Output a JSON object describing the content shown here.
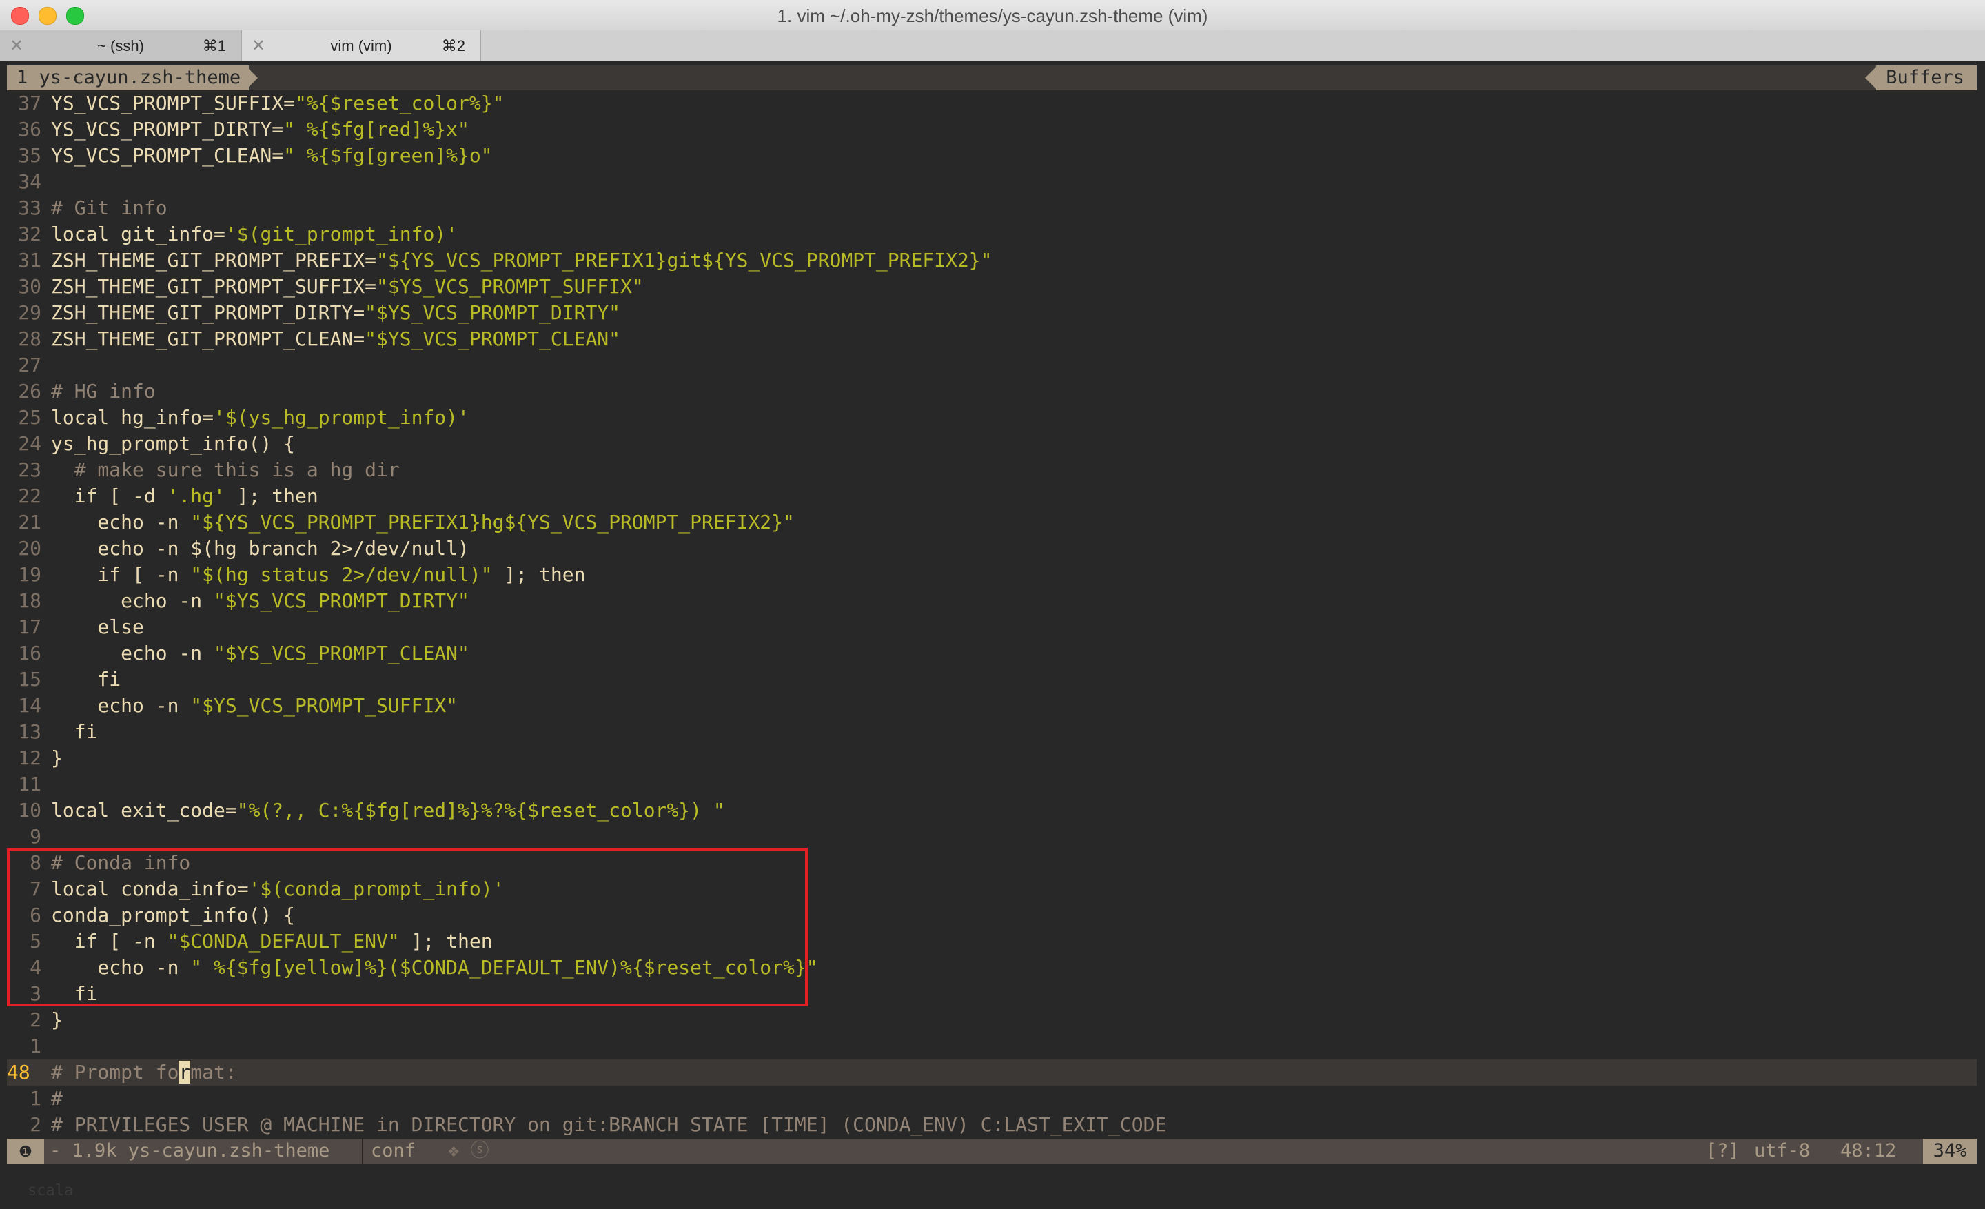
{
  "window": {
    "title": "1. vim ~/.oh-my-zsh/themes/ys-cayun.zsh-theme (vim)"
  },
  "tabs": [
    {
      "label": "~ (ssh)",
      "shortcut": "⌘1",
      "close": "✕"
    },
    {
      "label": "vim (vim)",
      "shortcut": "⌘2",
      "close": "✕"
    }
  ],
  "vim": {
    "buffer_tab": "1  ys-cayun.zsh-theme",
    "buffers_label": "Buffers",
    "lines": [
      {
        "n": "37",
        "segs": [
          [
            "v",
            "YS_VCS_PROMPT_SUFFIX="
          ],
          [
            "s",
            "\"%{$reset_color%}\""
          ]
        ]
      },
      {
        "n": "36",
        "segs": [
          [
            "v",
            "YS_VCS_PROMPT_DIRTY="
          ],
          [
            "s",
            "\" %{$fg[red]%}x\""
          ]
        ]
      },
      {
        "n": "35",
        "segs": [
          [
            "v",
            "YS_VCS_PROMPT_CLEAN="
          ],
          [
            "s",
            "\" %{$fg[green]%}o\""
          ]
        ]
      },
      {
        "n": "34",
        "segs": []
      },
      {
        "n": "33",
        "segs": [
          [
            "c",
            "# Git info"
          ]
        ]
      },
      {
        "n": "32",
        "segs": [
          [
            "v",
            "local git_info="
          ],
          [
            "s",
            "'$(git_prompt_info)'"
          ]
        ]
      },
      {
        "n": "31",
        "segs": [
          [
            "v",
            "ZSH_THEME_GIT_PROMPT_PREFIX="
          ],
          [
            "s",
            "\"${YS_VCS_PROMPT_PREFIX1}git${YS_VCS_PROMPT_PREFIX2}\""
          ]
        ]
      },
      {
        "n": "30",
        "segs": [
          [
            "v",
            "ZSH_THEME_GIT_PROMPT_SUFFIX="
          ],
          [
            "s",
            "\"$YS_VCS_PROMPT_SUFFIX\""
          ]
        ]
      },
      {
        "n": "29",
        "segs": [
          [
            "v",
            "ZSH_THEME_GIT_PROMPT_DIRTY="
          ],
          [
            "s",
            "\"$YS_VCS_PROMPT_DIRTY\""
          ]
        ]
      },
      {
        "n": "28",
        "segs": [
          [
            "v",
            "ZSH_THEME_GIT_PROMPT_CLEAN="
          ],
          [
            "s",
            "\"$YS_VCS_PROMPT_CLEAN\""
          ]
        ]
      },
      {
        "n": "27",
        "segs": []
      },
      {
        "n": "26",
        "segs": [
          [
            "c",
            "# HG info"
          ]
        ]
      },
      {
        "n": "25",
        "segs": [
          [
            "v",
            "local hg_info="
          ],
          [
            "s",
            "'$(ys_hg_prompt_info)'"
          ]
        ]
      },
      {
        "n": "24",
        "segs": [
          [
            "v",
            "ys_hg_prompt_info() {"
          ]
        ]
      },
      {
        "n": "23",
        "segs": [
          [
            "c",
            "  # make sure this is a hg dir"
          ]
        ]
      },
      {
        "n": "22",
        "segs": [
          [
            "v",
            "  if [ -d "
          ],
          [
            "s",
            "'.hg'"
          ],
          [
            "v",
            " ]; then"
          ]
        ]
      },
      {
        "n": "21",
        "segs": [
          [
            "v",
            "    echo -n "
          ],
          [
            "s",
            "\"${YS_VCS_PROMPT_PREFIX1}hg${YS_VCS_PROMPT_PREFIX2}\""
          ]
        ]
      },
      {
        "n": "20",
        "segs": [
          [
            "v",
            "    echo -n $(hg branch 2>/dev/null)"
          ]
        ]
      },
      {
        "n": "19",
        "segs": [
          [
            "v",
            "    if [ -n "
          ],
          [
            "s",
            "\"$(hg status 2>/dev/null)\""
          ],
          [
            "v",
            " ]; then"
          ]
        ]
      },
      {
        "n": "18",
        "segs": [
          [
            "v",
            "      echo -n "
          ],
          [
            "s",
            "\"$YS_VCS_PROMPT_DIRTY\""
          ]
        ]
      },
      {
        "n": "17",
        "segs": [
          [
            "v",
            "    else"
          ]
        ]
      },
      {
        "n": "16",
        "segs": [
          [
            "v",
            "      echo -n "
          ],
          [
            "s",
            "\"$YS_VCS_PROMPT_CLEAN\""
          ]
        ]
      },
      {
        "n": "15",
        "segs": [
          [
            "v",
            "    fi"
          ]
        ]
      },
      {
        "n": "14",
        "segs": [
          [
            "v",
            "    echo -n "
          ],
          [
            "s",
            "\"$YS_VCS_PROMPT_SUFFIX\""
          ]
        ]
      },
      {
        "n": "13",
        "segs": [
          [
            "v",
            "  fi"
          ]
        ]
      },
      {
        "n": "12",
        "segs": [
          [
            "v",
            "}"
          ]
        ]
      },
      {
        "n": "11",
        "segs": []
      },
      {
        "n": "10",
        "segs": [
          [
            "v",
            "local exit_code="
          ],
          [
            "s",
            "\"%(?,, C:%{$fg[red]%}%?%{$reset_color%}) \""
          ]
        ]
      },
      {
        "n": "9",
        "segs": []
      },
      {
        "n": "8",
        "segs": [
          [
            "c",
            "# Conda info"
          ]
        ]
      },
      {
        "n": "7",
        "segs": [
          [
            "v",
            "local conda_info="
          ],
          [
            "s",
            "'$(conda_prompt_info)'"
          ]
        ]
      },
      {
        "n": "6",
        "segs": [
          [
            "v",
            "conda_prompt_info() {"
          ]
        ]
      },
      {
        "n": "5",
        "segs": [
          [
            "v",
            "  if [ -n "
          ],
          [
            "s",
            "\"$CONDA_DEFAULT_ENV\""
          ],
          [
            "v",
            " ]; then"
          ]
        ]
      },
      {
        "n": "4",
        "segs": [
          [
            "v",
            "    echo -n "
          ],
          [
            "s",
            "\" %{$fg[yellow]%}($CONDA_DEFAULT_ENV)%{$reset_color%}\""
          ]
        ]
      },
      {
        "n": "3",
        "segs": [
          [
            "v",
            "  fi"
          ]
        ]
      },
      {
        "n": "2",
        "segs": [
          [
            "v",
            "}"
          ]
        ]
      },
      {
        "n": "1",
        "segs": []
      },
      {
        "n": "48",
        "current": true,
        "segs": [
          [
            "c",
            "# Prompt fo"
          ],
          [
            "cur",
            "r"
          ],
          [
            "c",
            "mat:"
          ]
        ]
      },
      {
        "n": "1",
        "segs": [
          [
            "c",
            "#"
          ]
        ]
      },
      {
        "n": "2",
        "segs": [
          [
            "c",
            "# PRIVILEGES USER @ MACHINE in DIRECTORY on git:BRANCH STATE [TIME] (CONDA_ENV) C:LAST_EXIT_CODE"
          ]
        ]
      }
    ],
    "status": {
      "mode_icon": "❶",
      "file": "- 1.9k ys-cayun.zsh-theme",
      "filetype": "conf",
      "symbols": "❖ ⓢ",
      "format_icon": "[?]",
      "encoding": "utf-8",
      "position": "48:12",
      "percent": "34%"
    },
    "faint_text": "scala"
  },
  "colors": {
    "bg": "#282828",
    "string": "#b8bb26",
    "comment": "#928374",
    "highlight_box": "#e31e24"
  }
}
